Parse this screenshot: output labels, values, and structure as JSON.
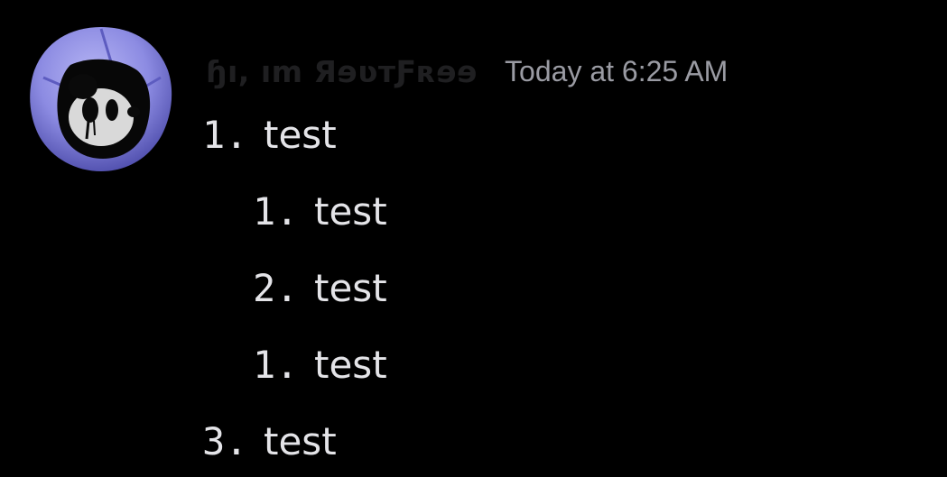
{
  "message": {
    "author": {
      "display_name": "ɧı, ım ЯɘʋтƑʀɘɘ",
      "avatar_icon": "hooded-cartoon-avatar-icon"
    },
    "timestamp": "Today at 6:25 AM",
    "list": [
      {
        "marker": "1.",
        "text": "test",
        "level": 1
      },
      {
        "marker": "1.",
        "text": "test",
        "level": 2
      },
      {
        "marker": "2.",
        "text": "test",
        "level": 2
      },
      {
        "marker": "1.",
        "text": "test",
        "level": 2
      },
      {
        "marker": "3.",
        "text": "test",
        "level": 1
      }
    ]
  },
  "colors": {
    "background": "#000000",
    "username": "#1f1f21",
    "timestamp": "#9a9ba3",
    "text": "#e4e4e8",
    "avatar_hood": "#8f8ee6"
  }
}
